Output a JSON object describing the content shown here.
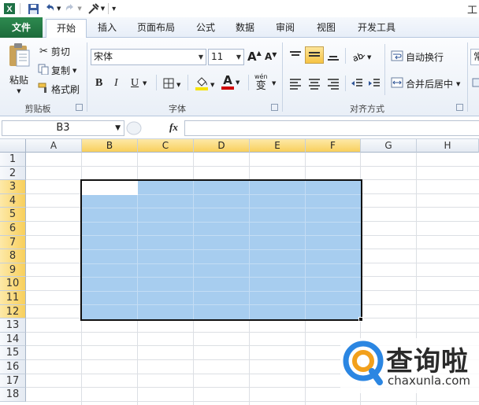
{
  "qat": {
    "title_fragment": "工",
    "icons": [
      "excel-logo-icon",
      "save-icon",
      "undo-icon",
      "redo-icon",
      "tools-icon",
      "customize-icon"
    ]
  },
  "tabs": {
    "file": "文件",
    "home": "开始",
    "insert": "插入",
    "page_layout": "页面布局",
    "formulas": "公式",
    "data": "数据",
    "review": "审阅",
    "view": "视图",
    "developer": "开发工具"
  },
  "ribbon": {
    "clipboard": {
      "paste": "粘贴",
      "cut": "剪切",
      "copy": "复制",
      "format_painter": "格式刷",
      "label": "剪贴板"
    },
    "font": {
      "font_name": "宋体",
      "font_size": "11",
      "bold": "B",
      "italic": "I",
      "underline": "U",
      "font_color_glyph": "A",
      "wen_glyph": "wén",
      "bian_glyph": "变",
      "label": "字体"
    },
    "alignment": {
      "wrap_text": "自动换行",
      "merge_center": "合并后居中",
      "label": "对齐方式"
    },
    "number": {
      "partial_label": "常"
    }
  },
  "formula_bar": {
    "name_box": "B3",
    "fx": "fx",
    "formula": ""
  },
  "grid": {
    "columns": [
      "A",
      "B",
      "C",
      "D",
      "E",
      "F",
      "G",
      "H"
    ],
    "rows": [
      "1",
      "2",
      "3",
      "4",
      "5",
      "6",
      "7",
      "8",
      "9",
      "10",
      "11",
      "12",
      "13",
      "14",
      "15",
      "16",
      "17",
      "18"
    ],
    "selected_columns": [
      "B",
      "C",
      "D",
      "E",
      "F"
    ],
    "selected_rows": [
      "3",
      "4",
      "5",
      "6",
      "7",
      "8",
      "9",
      "10",
      "11",
      "12"
    ],
    "selection_range": "B3:F12",
    "active_cell": "B3",
    "selection_color": "#a7cdef"
  },
  "watermark": {
    "text": "查询啦",
    "url": "chaxunla.com"
  },
  "colors": {
    "file_tab": "#217346",
    "header_selected": "#f8cf5c",
    "font_color_bar": "#d00000",
    "fill_color_bar": "#f7e300"
  }
}
